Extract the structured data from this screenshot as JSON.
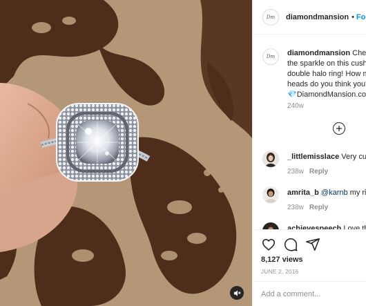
{
  "header": {
    "username": "diamondmansion",
    "separator": "•",
    "follow_label": "Follow",
    "avatar_logo": "Dm"
  },
  "caption": {
    "username": "diamondmansion",
    "text": "Check out the sparkle on this cushion-cut double halo ring! How many heads do you think you'd turn?",
    "link_text": "💎DiamondMansion.com",
    "time": "240w"
  },
  "comments": [
    {
      "username": "_littlemisslace",
      "text": "Very cute",
      "time": "238w",
      "reply_label": "Reply"
    },
    {
      "username": "amrita_b",
      "mention": "@karnb",
      "text": " my ring",
      "time": "238w",
      "reply_label": "Reply"
    },
    {
      "username": "achievespeech",
      "text": "Love this"
    }
  ],
  "actions": {
    "icons": [
      "heart-icon",
      "comment-icon",
      "share-icon"
    ],
    "views": "8,127 views",
    "date": "JUNE 2, 2016",
    "add_comment_placeholder": "Add a comment..."
  },
  "colors": {
    "link_blue": "#0095f6",
    "mention_blue": "#00376b",
    "muted": "#8e8e8e",
    "text": "#262626",
    "backdrop_tan": "#b89b7a",
    "pattern_brown": "#4e2d1a"
  }
}
